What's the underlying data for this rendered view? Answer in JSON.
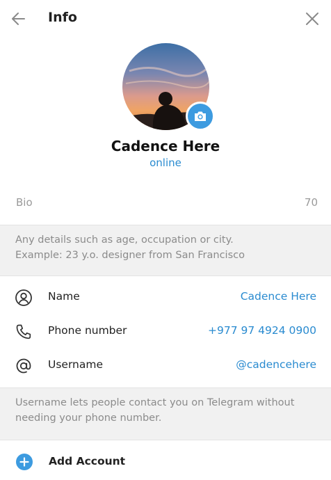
{
  "header": {
    "title": "Info",
    "back_icon": "arrow-left-icon",
    "close_icon": "close-icon"
  },
  "profile": {
    "name": "Cadence Here",
    "status": "online",
    "camera_icon": "camera-icon"
  },
  "bio": {
    "placeholder": "Bio",
    "counter": "70",
    "hint_line1": "Any details such as age, occupation or city.",
    "hint_line2": "Example: 23 y.o. designer from San Francisco"
  },
  "info_rows": [
    {
      "icon": "user-circle-icon",
      "label": "Name",
      "value": "Cadence Here"
    },
    {
      "icon": "phone-icon",
      "label": "Phone number",
      "value": "+977 97 4924 0900"
    },
    {
      "icon": "at-sign-icon",
      "label": "Username",
      "value": "@cadencehere"
    }
  ],
  "username_hint": {
    "line1": "Username lets people contact you on Telegram without",
    "line2": "needing your phone number."
  },
  "add_account": {
    "label": "Add Account",
    "icon": "plus-circle-icon"
  },
  "colors": {
    "accent": "#2a8bd0",
    "camera_button": "#3d9be0",
    "hint_background": "#f1f1f1"
  }
}
